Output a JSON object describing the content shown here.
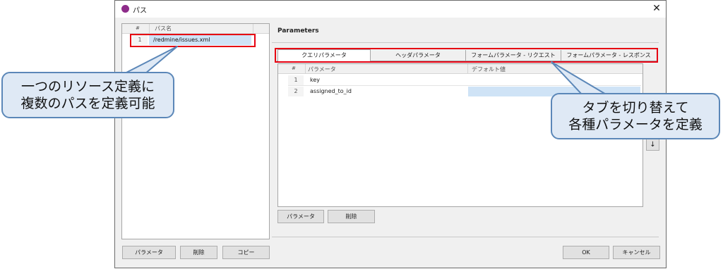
{
  "dialog": {
    "title": "パス",
    "close_label": "✕"
  },
  "paths_table": {
    "headers": [
      "#",
      "パス名"
    ],
    "rows": [
      {
        "num": "1",
        "path": "/redmine/issues.xml"
      }
    ]
  },
  "left_buttons": {
    "add_label": "パラメータ",
    "delete_label": "削除",
    "copy_label": "コピー"
  },
  "parameters": {
    "heading": "Parameters",
    "tabs": [
      {
        "label": "クエリパラメータ",
        "active": true
      },
      {
        "label": "ヘッダパラメータ",
        "active": false
      },
      {
        "label": "フォームパラメータ - リクエスト",
        "active": false
      },
      {
        "label": "フォームパラメータ - レスポンス",
        "active": false
      }
    ],
    "headers": [
      "#",
      "パラメータ",
      "デフォルト値"
    ],
    "rows": [
      {
        "num": "1",
        "name": "key",
        "default": ""
      },
      {
        "num": "2",
        "name": "assigned_to_id",
        "default": ""
      }
    ],
    "add_label": "パラメータ",
    "delete_label": "削除"
  },
  "footer": {
    "ok_label": "OK",
    "cancel_label": "キャンセル"
  },
  "callouts": {
    "left_line1": "一つのリソース定義に",
    "left_line2": "複数のパスを定義可能",
    "right_line1": "タブを切り替えて",
    "right_line2": "各種パラメータを定義"
  },
  "icons": {
    "app": "app-logo-icon",
    "close": "close-icon",
    "down": "arrow-down-icon"
  },
  "colors": {
    "highlight": "#e60012",
    "callout_fill": "#dfe9f5",
    "callout_border": "#5b87b8",
    "selection": "#cfe3f6"
  }
}
